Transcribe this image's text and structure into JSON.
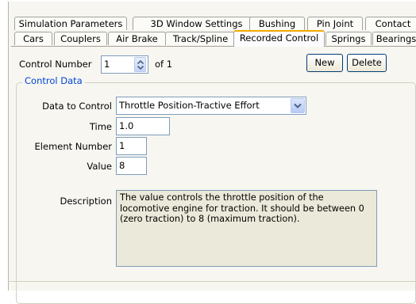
{
  "tabs_row1": [
    {
      "label": "Simulation Parameters"
    },
    {
      "label": "3D Window Settings"
    },
    {
      "label": "Bushing"
    },
    {
      "label": "Pin Joint"
    },
    {
      "label": "Contact"
    }
  ],
  "tabs_row2": [
    {
      "label": "Cars"
    },
    {
      "label": "Couplers"
    },
    {
      "label": "Air Brake"
    },
    {
      "label": "Track/Spline"
    },
    {
      "label": "Recorded Control",
      "active": true
    },
    {
      "label": "Springs"
    },
    {
      "label": "Bearings"
    }
  ],
  "control_number": {
    "label": "Control Number",
    "value": "1",
    "of_text": "of 1"
  },
  "buttons": {
    "new_label": "New",
    "delete_label": "Delete"
  },
  "group": {
    "title": "Control Data"
  },
  "fields": {
    "data_to_control_label": "Data to Control",
    "data_to_control_value": "Throttle Position-Tractive Effort",
    "time_label": "Time",
    "time_value": "1.0",
    "element_number_label": "Element Number",
    "element_number_value": "1",
    "value_label": "Value",
    "value_value": "8",
    "description_label": "Description",
    "description_text": "The value controls the throttle position of the locomotive engine for traction. It should be between 0 (zero traction) to 8 (maximum traction)."
  },
  "icons": {
    "spinner": "spinner-up-down-icon",
    "dropdown": "chevron-down-icon"
  },
  "colors": {
    "active_tab_accent": "#f2a900",
    "group_title": "#0046d5",
    "description_bg": "#ebe9d9",
    "pane_bg": "#f7f6f1"
  }
}
